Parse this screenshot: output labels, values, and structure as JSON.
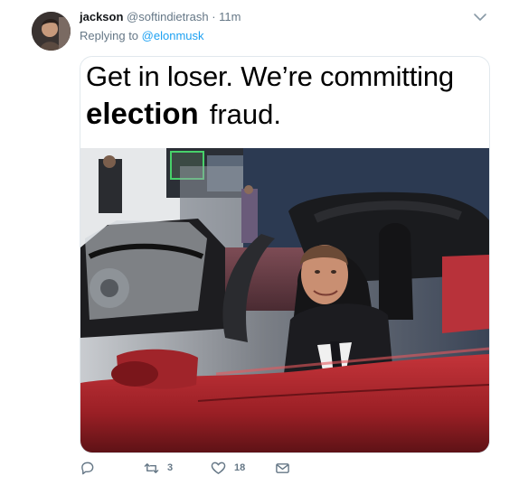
{
  "tweet": {
    "display_name": "jackson",
    "handle": "@softindietrash",
    "separator": "·",
    "time": "11m",
    "replying_prefix": "Replying to",
    "replying_to": "@elonmusk",
    "menu_icon": "chevron-down-icon"
  },
  "media": {
    "line1": "Get in loser. We’re committing",
    "line2_bold": "election",
    "line2_rest": "fraud.",
    "photo_description_icon": "photo"
  },
  "actions": {
    "reply_icon": "reply-icon",
    "retweet_count": "3",
    "like_count": "18",
    "dm_icon": "envelope-icon"
  },
  "colors": {
    "link": "#1da1f2",
    "muted": "#657786",
    "text": "#14171a",
    "car_red": "#b3262c"
  }
}
